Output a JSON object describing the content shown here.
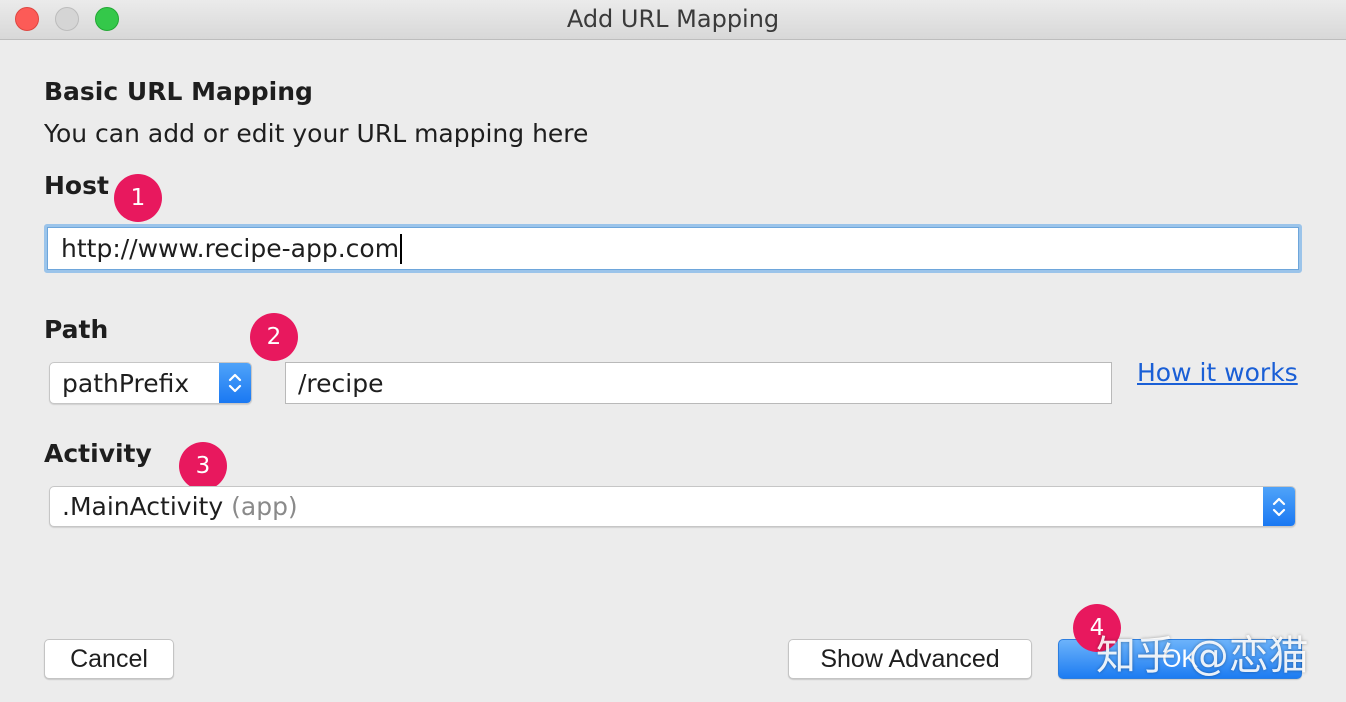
{
  "window": {
    "title": "Add URL Mapping"
  },
  "form": {
    "heading": "Basic URL Mapping",
    "subheading": "You can add or edit your URL mapping here",
    "host": {
      "label": "Host",
      "value": "http://www.recipe-app.com"
    },
    "path": {
      "label": "Path",
      "type_selected": "pathPrefix",
      "value": "/recipe",
      "help_link": "How it works"
    },
    "activity": {
      "label": "Activity",
      "selected_name": ".MainActivity",
      "selected_module": "(app)"
    }
  },
  "annotations": {
    "badge1": "1",
    "badge2": "2",
    "badge3": "3",
    "badge4": "4",
    "color": "#e8185e"
  },
  "buttons": {
    "cancel": "Cancel",
    "show_advanced": "Show Advanced",
    "ok": "OK"
  },
  "watermark": "知乎 @恋猫"
}
